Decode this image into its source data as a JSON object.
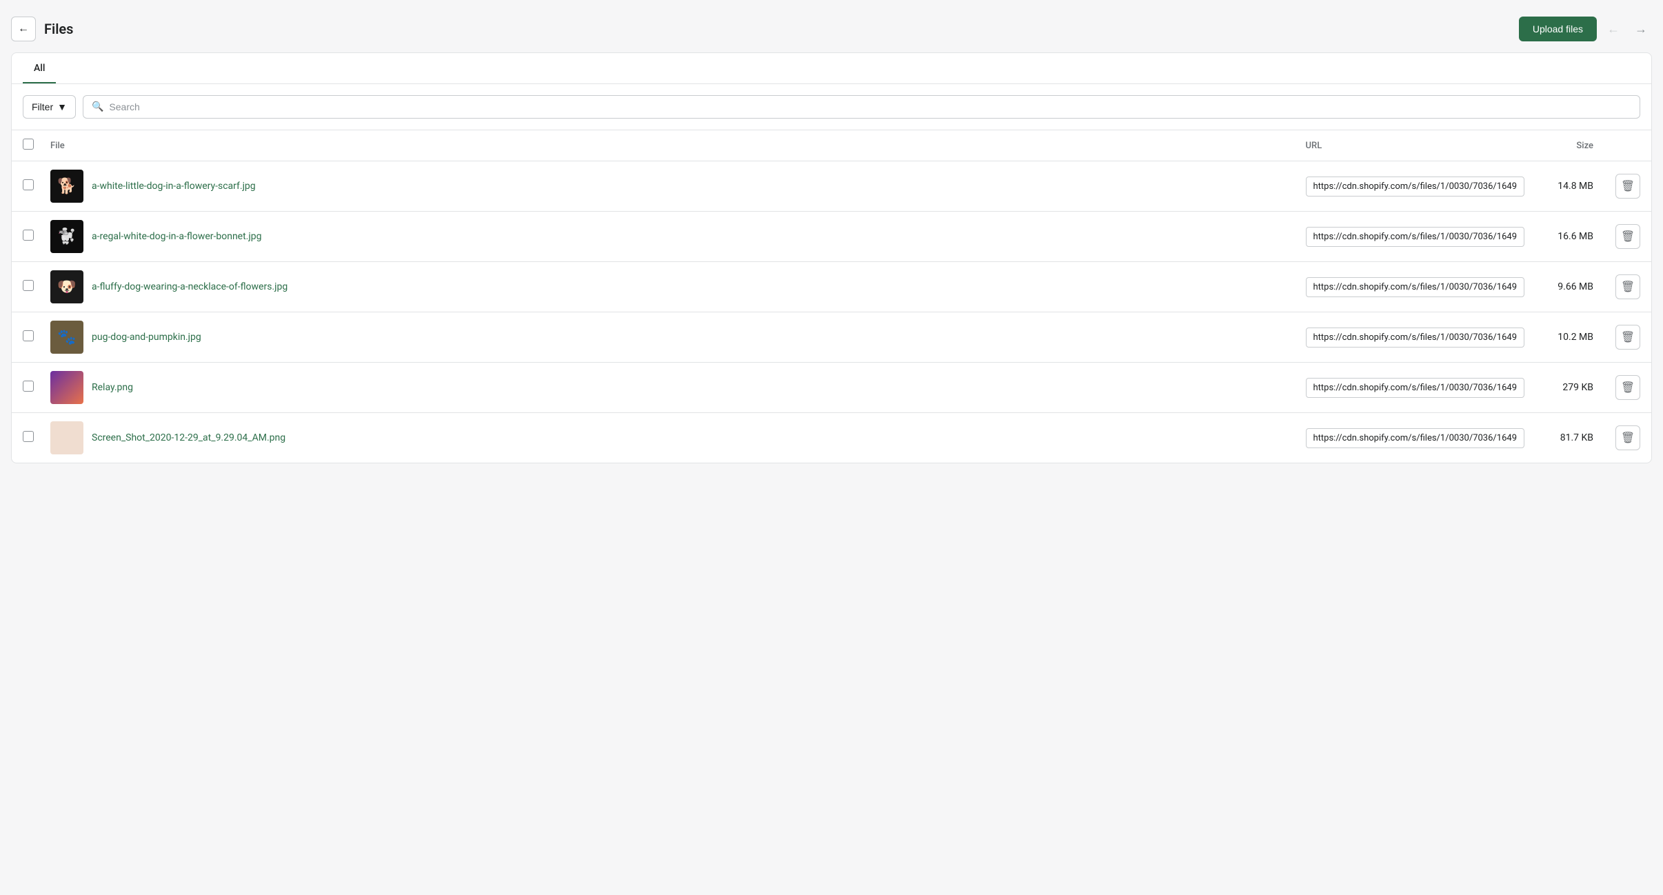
{
  "header": {
    "title": "Files",
    "upload_label": "Upload files",
    "back_aria": "Back",
    "nav_prev_aria": "Previous",
    "nav_next_aria": "Next"
  },
  "tabs": [
    {
      "id": "all",
      "label": "All",
      "active": true
    }
  ],
  "toolbar": {
    "filter_label": "Filter",
    "search_placeholder": "Search"
  },
  "table": {
    "headers": {
      "file": "File",
      "url": "URL",
      "size": "Size"
    },
    "rows": [
      {
        "id": "row-1",
        "name": "a-white-little-dog-in-a-flowery-scarf.jpg",
        "url": "https://cdn.shopify.com/s/files/1/0030/7036/1649",
        "size": "14.8 MB",
        "thumb_type": "dog1"
      },
      {
        "id": "row-2",
        "name": "a-regal-white-dog-in-a-flower-bonnet.jpg",
        "url": "https://cdn.shopify.com/s/files/1/0030/7036/1649",
        "size": "16.6 MB",
        "thumb_type": "dog2"
      },
      {
        "id": "row-3",
        "name": "a-fluffy-dog-wearing-a-necklace-of-flowers.jpg",
        "url": "https://cdn.shopify.com/s/files/1/0030/7036/1649",
        "size": "9.66 MB",
        "thumb_type": "dog3"
      },
      {
        "id": "row-4",
        "name": "pug-dog-and-pumpkin.jpg",
        "url": "https://cdn.shopify.com/s/files/1/0030/7036/1649",
        "size": "10.2 MB",
        "thumb_type": "pug"
      },
      {
        "id": "row-5",
        "name": "Relay.png",
        "url": "https://cdn.shopify.com/s/files/1/0030/7036/1649",
        "size": "279 KB",
        "thumb_type": "relay"
      },
      {
        "id": "row-6",
        "name": "Screen_Shot_2020-12-29_at_9.29.04_AM.png",
        "url": "https://cdn.shopify.com/s/files/1/0030/7036/1649",
        "size": "81.7 KB",
        "thumb_type": "screenshot"
      }
    ]
  }
}
